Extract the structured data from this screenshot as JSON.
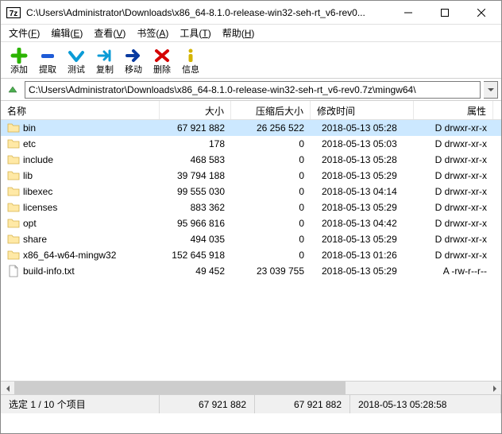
{
  "window": {
    "title": "C:\\Users\\Administrator\\Downloads\\x86_64-8.1.0-release-win32-seh-rt_v6-rev0..."
  },
  "menus": [
    {
      "label": "文件",
      "hotkey": "F"
    },
    {
      "label": "编辑",
      "hotkey": "E"
    },
    {
      "label": "查看",
      "hotkey": "V"
    },
    {
      "label": "书签",
      "hotkey": "A"
    },
    {
      "label": "工具",
      "hotkey": "T"
    },
    {
      "label": "帮助",
      "hotkey": "H"
    }
  ],
  "toolbar": [
    {
      "id": "add",
      "label": "添加"
    },
    {
      "id": "extract",
      "label": "提取"
    },
    {
      "id": "test",
      "label": "测试"
    },
    {
      "id": "copy",
      "label": "复制"
    },
    {
      "id": "move",
      "label": "移动"
    },
    {
      "id": "delete",
      "label": "删除"
    },
    {
      "id": "info",
      "label": "信息"
    }
  ],
  "path": "C:\\Users\\Administrator\\Downloads\\x86_64-8.1.0-release-win32-seh-rt_v6-rev0.7z\\mingw64\\",
  "columns": {
    "name": "名称",
    "size": "大小",
    "packed": "压缩后大小",
    "date": "修改时间",
    "attr": "属性"
  },
  "rows": [
    {
      "type": "folder",
      "name": "bin",
      "size": "67 921 882",
      "packed": "26 256 522",
      "date": "2018-05-13 05:28",
      "attr": "D drwxr-xr-x",
      "selected": true
    },
    {
      "type": "folder",
      "name": "etc",
      "size": "178",
      "packed": "0",
      "date": "2018-05-13 05:03",
      "attr": "D drwxr-xr-x"
    },
    {
      "type": "folder",
      "name": "include",
      "size": "468 583",
      "packed": "0",
      "date": "2018-05-13 05:28",
      "attr": "D drwxr-xr-x"
    },
    {
      "type": "folder",
      "name": "lib",
      "size": "39 794 188",
      "packed": "0",
      "date": "2018-05-13 05:29",
      "attr": "D drwxr-xr-x"
    },
    {
      "type": "folder",
      "name": "libexec",
      "size": "99 555 030",
      "packed": "0",
      "date": "2018-05-13 04:14",
      "attr": "D drwxr-xr-x"
    },
    {
      "type": "folder",
      "name": "licenses",
      "size": "883 362",
      "packed": "0",
      "date": "2018-05-13 05:29",
      "attr": "D drwxr-xr-x"
    },
    {
      "type": "folder",
      "name": "opt",
      "size": "95 966 816",
      "packed": "0",
      "date": "2018-05-13 04:42",
      "attr": "D drwxr-xr-x"
    },
    {
      "type": "folder",
      "name": "share",
      "size": "494 035",
      "packed": "0",
      "date": "2018-05-13 05:29",
      "attr": "D drwxr-xr-x"
    },
    {
      "type": "folder",
      "name": "x86_64-w64-mingw32",
      "size": "152 645 918",
      "packed": "0",
      "date": "2018-05-13 01:26",
      "attr": "D drwxr-xr-x"
    },
    {
      "type": "file",
      "name": "build-info.txt",
      "size": "49 452",
      "packed": "23 039 755",
      "date": "2018-05-13 05:29",
      "attr": "A -rw-r--r--"
    }
  ],
  "status": {
    "selection": "选定 1 / 10 个项目",
    "size": "67 921 882",
    "packed": "67 921 882",
    "date": "2018-05-13 05:28:58"
  }
}
